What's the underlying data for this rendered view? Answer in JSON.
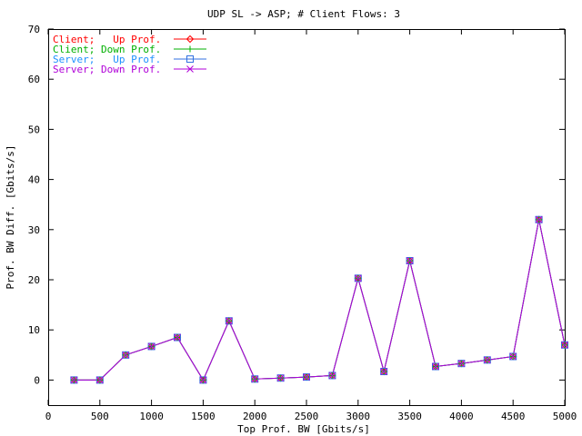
{
  "chart_data": {
    "type": "line",
    "title": "UDP SL -> ASP; # Client Flows: 3",
    "xlabel": "Top Prof. BW [Gbits/s]",
    "ylabel": "Prof. BW Diff. [Gbits/s]",
    "xlim": [
      0,
      5000
    ],
    "ylim": [
      -5,
      70
    ],
    "xticks": [
      0,
      500,
      1000,
      1500,
      2000,
      2500,
      3000,
      3500,
      4000,
      4500,
      5000
    ],
    "yticks": [
      0,
      10,
      20,
      30,
      40,
      50,
      60,
      70
    ],
    "grid": false,
    "legend_position": "top-left",
    "x": [
      250,
      500,
      750,
      1000,
      1250,
      1500,
      1750,
      2000,
      2250,
      2500,
      2750,
      3000,
      3250,
      3500,
      3750,
      4000,
      4250,
      4500,
      4750,
      5000
    ],
    "series": [
      {
        "name": "Client;   Up Prof.",
        "label_color": "#ff0000",
        "color": "#ff0000",
        "marker": "diamond",
        "values": [
          0,
          0,
          5,
          6.7,
          8.5,
          0,
          11.8,
          0.2,
          0.4,
          0.6,
          0.9,
          20.3,
          1.7,
          23.8,
          2.7,
          3.3,
          4.0,
          4.7,
          32,
          7
        ]
      },
      {
        "name": "Client; Down Prof.",
        "label_color": "#00b000",
        "color": "#00b000",
        "marker": "plus",
        "values": [
          0,
          0,
          5,
          6.7,
          8.5,
          0,
          11.8,
          0.2,
          0.4,
          0.6,
          0.9,
          20.3,
          1.7,
          23.8,
          2.7,
          3.3,
          4.0,
          4.7,
          32,
          7
        ]
      },
      {
        "name": "Server;   Up Prof.",
        "label_color": "#1e90ff",
        "color": "#3070e0",
        "marker": "square",
        "values": [
          0,
          0,
          5,
          6.7,
          8.5,
          0,
          11.8,
          0.2,
          0.4,
          0.6,
          0.9,
          20.3,
          1.7,
          23.8,
          2.7,
          3.3,
          4.0,
          4.7,
          32,
          7
        ]
      },
      {
        "name": "Server; Down Prof.",
        "label_color": "#b000d8",
        "color": "#b000d8",
        "marker": "x",
        "values": [
          0,
          0,
          5,
          6.7,
          8.5,
          0,
          11.8,
          0.2,
          0.4,
          0.6,
          0.9,
          20.3,
          1.7,
          23.8,
          2.7,
          3.3,
          4.0,
          4.7,
          32,
          7
        ]
      }
    ]
  }
}
